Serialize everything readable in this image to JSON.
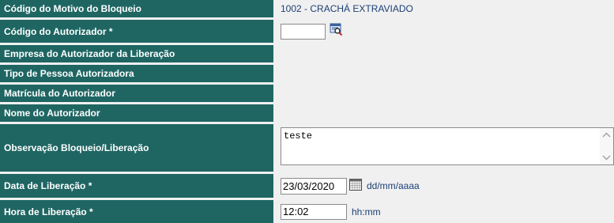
{
  "fields": {
    "motivo": {
      "label": "Código do Motivo do Bloqueio",
      "value": "1002 - CRACHÁ EXTRAVIADO"
    },
    "autorizador": {
      "label": "Código do Autorizador *",
      "value": "",
      "lookup_icon": "search-lookup-icon"
    },
    "empresa": {
      "label": "Empresa do Autorizador da Liberação",
      "value": ""
    },
    "tipo_pessoa": {
      "label": "Tipo de Pessoa Autorizadora",
      "value": ""
    },
    "matricula": {
      "label": "Matrícula do Autorizador",
      "value": ""
    },
    "nome": {
      "label": "Nome do Autorizador",
      "value": ""
    },
    "observacao": {
      "label": "Observação Bloqueio/Liberação",
      "value": "teste"
    },
    "data": {
      "label": "Data de Liberação *",
      "value": "23/03/2020",
      "format_hint": "dd/mm/aaaa",
      "calendar_icon": "calendar-icon"
    },
    "hora": {
      "label": "Hora de Liberação *",
      "value": "12:02",
      "format_hint": "hh:mm"
    }
  },
  "colors": {
    "label_background": "#1f6663",
    "label_text": "#ffffff",
    "value_text": "#1c3f75",
    "page_background": "#f0f0f0"
  }
}
